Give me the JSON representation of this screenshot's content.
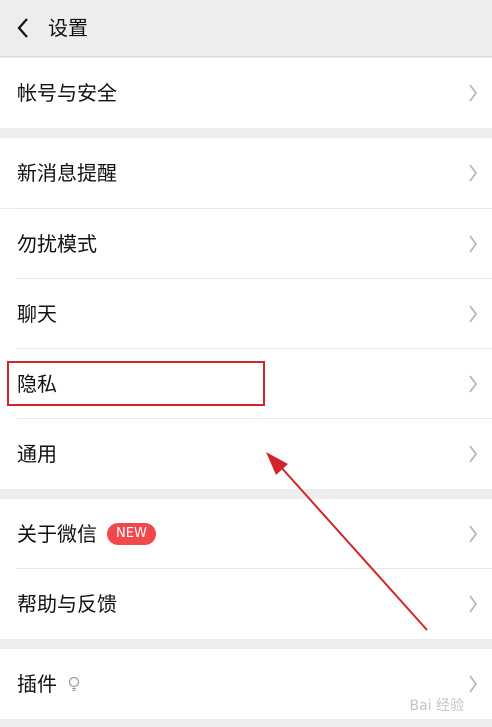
{
  "header": {
    "title": "设置",
    "back_icon": "chevron-left-icon"
  },
  "groups": [
    {
      "items": [
        {
          "label": "帐号与安全"
        }
      ]
    },
    {
      "items": [
        {
          "label": "新消息提醒"
        },
        {
          "label": "勿扰模式"
        },
        {
          "label": "聊天"
        },
        {
          "label": "隐私"
        },
        {
          "label": "通用"
        }
      ]
    },
    {
      "items": [
        {
          "label": "关于微信",
          "badge": "NEW"
        },
        {
          "label": "帮助与反馈"
        }
      ]
    },
    {
      "items": [
        {
          "label": "插件",
          "icon": "bulb-icon"
        }
      ]
    }
  ],
  "colors": {
    "page_background": "#ededed",
    "row_background": "#ffffff",
    "badge": "#f0484d",
    "annotation": "#d0262b"
  },
  "watermark": "Bai 经验"
}
